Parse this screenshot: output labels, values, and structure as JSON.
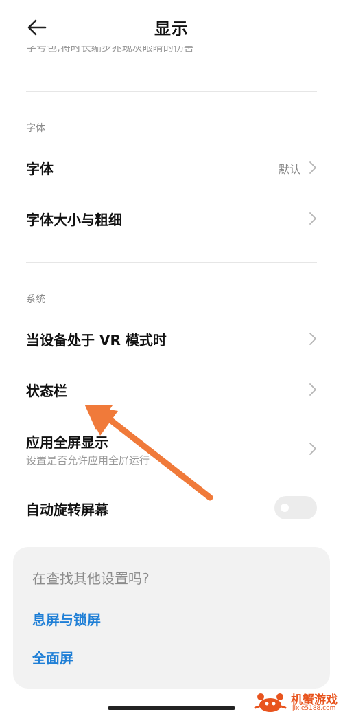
{
  "header": {
    "title": "显示",
    "cut_text": "字号包,将时长编步兆现灰眼睛的伤害"
  },
  "sections": [
    {
      "label": "字体",
      "items": [
        {
          "title": "字体",
          "value": "默认"
        },
        {
          "title": "字体大小与粗细"
        }
      ]
    },
    {
      "label": "系统",
      "items": [
        {
          "title": "当设备处于 VR 模式时"
        },
        {
          "title": "状态栏"
        },
        {
          "title": "应用全屏显示",
          "subtitle": "设置是否允许应用全屏运行"
        },
        {
          "title": "自动旋转屏幕",
          "toggle": false
        }
      ]
    }
  ],
  "suggestions": {
    "title": "在查找其他设置吗?",
    "links": [
      "息屏与锁屏",
      "全面屏"
    ]
  },
  "watermark": {
    "name": "机蟹游戏",
    "url": "jixie5188.com"
  },
  "colors": {
    "link": "#1f7fd6",
    "annotation_arrow": "#f07a3a",
    "card_bg": "#f2f2f2"
  },
  "icons": {
    "back": "arrow-left-icon",
    "chevron": "chevron-right-icon"
  }
}
